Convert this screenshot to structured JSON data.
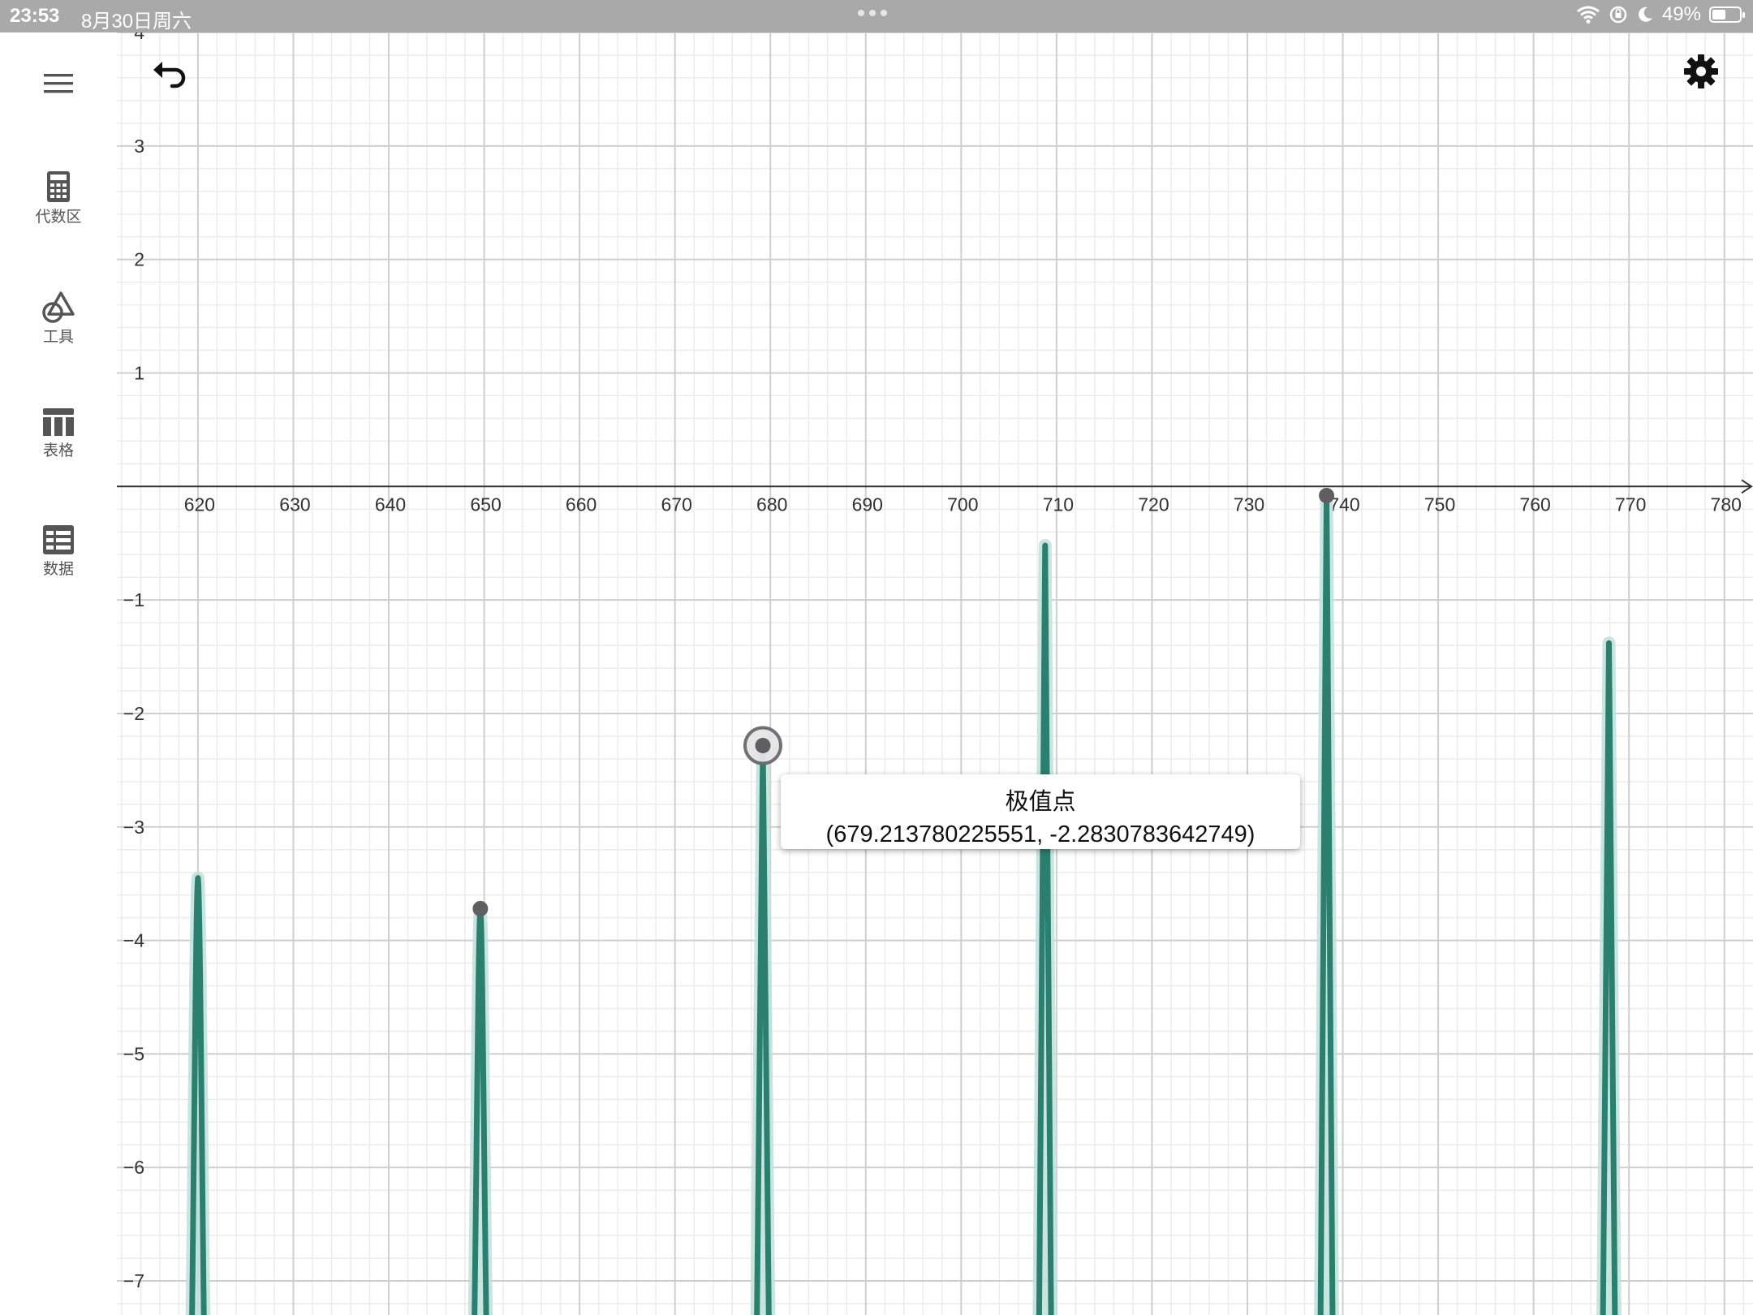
{
  "status_bar": {
    "time": "23:53",
    "date": "8月30日周六",
    "battery": "49%",
    "battery_level": 0.49
  },
  "sidebar": {
    "items": [
      {
        "label": "代数区",
        "icon": "calculator-icon"
      },
      {
        "label": "工具",
        "icon": "shapes-icon"
      },
      {
        "label": "表格",
        "icon": "table-icon"
      },
      {
        "label": "数据",
        "icon": "data-icon"
      }
    ]
  },
  "toolbar": {
    "undo_icon": "undo-icon",
    "settings_icon": "gear-icon",
    "menu_icon": "hamburger-menu-icon"
  },
  "colors": {
    "curve": "#2a7f6e",
    "curve_halo": "#bfe1da",
    "point": "#5f5f62",
    "grid_major": "#cfcfcf",
    "grid_minor": "#ececec"
  },
  "tooltip": {
    "title": "极值点",
    "coords": "(679.213780225551, -2.2830783642749)"
  },
  "chart_data": {
    "type": "line",
    "xlim": [
      611.5,
      783
    ],
    "ylim": [
      -7.3,
      4.0
    ],
    "x_ticks": [
      620,
      630,
      640,
      650,
      660,
      670,
      680,
      690,
      700,
      710,
      720,
      730,
      740,
      750,
      760,
      770,
      780
    ],
    "y_ticks": [
      4,
      3,
      2,
      1,
      -1,
      -2,
      -3,
      -4,
      -5,
      -6,
      -7
    ],
    "x_tick_labels": [
      "620",
      "630",
      "640",
      "650",
      "660",
      "670",
      "680",
      "690",
      "700",
      "710",
      "720",
      "730",
      "740",
      "750",
      "760",
      "770",
      "780"
    ],
    "y_tick_labels": [
      "4",
      "3",
      "2",
      "1",
      "−1",
      "−2",
      "−3",
      "−4",
      "−5",
      "−6",
      "−7"
    ],
    "grid": true,
    "peaks": [
      {
        "x": 620.0,
        "y": -3.45
      },
      {
        "x": 649.6,
        "y": -3.72
      },
      {
        "x": 679.2138,
        "y": -2.2831
      },
      {
        "x": 708.8,
        "y": -0.52
      },
      {
        "x": 738.3,
        "y": -0.08
      },
      {
        "x": 767.9,
        "y": -1.38
      }
    ],
    "marked_points": [
      {
        "x": 649.6,
        "y": -3.72
      },
      {
        "x": 679.2138,
        "y": -2.2831,
        "selected": true
      },
      {
        "x": 738.3,
        "y": -0.08
      }
    ]
  }
}
